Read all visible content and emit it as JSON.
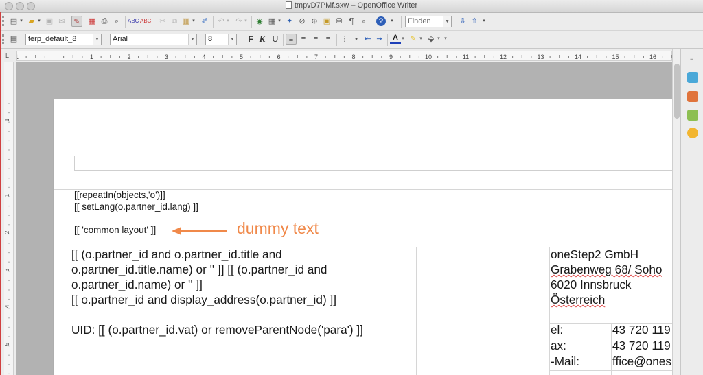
{
  "window": {
    "title": "tmpvD7PMf.sxw – OpenOffice Writer"
  },
  "standard_toolbar": {
    "find_value": "Finden",
    "icons": [
      "new-document-icon",
      "open-folder-icon",
      "save-icon",
      "export-pdf-icon",
      "edit-file-icon",
      "print-icon",
      "page-preview-icon",
      "spellcheck-icon",
      "autospellcheck-icon",
      "cut-icon",
      "copy-icon",
      "paste-icon",
      "format-paintbrush-icon",
      "undo-icon",
      "redo-icon",
      "hyperlink-icon",
      "table-icon",
      "draw-functions-icon",
      "navigator-icon",
      "gallery-icon",
      "data-sources-icon",
      "formatting-marks-icon",
      "zoom-icon",
      "help-icon"
    ]
  },
  "formatting_toolbar": {
    "paragraph_style": "terp_default_8",
    "font_name": "Arial",
    "font_size": "8",
    "bold_label": "F",
    "italic_label": "K",
    "underline_label": "U"
  },
  "ruler": {
    "corner_label": "L",
    "h_labels": [
      "1",
      "1",
      "2",
      "3",
      "4",
      "5",
      "6",
      "7",
      "8",
      "9",
      "10",
      "11",
      "12",
      "13",
      "14",
      "15",
      "16"
    ],
    "v_labels": [
      "1",
      "1",
      "2",
      "3",
      "4",
      "5"
    ]
  },
  "document": {
    "lines": [
      "[[repeatIn(objects,'o')]]",
      "[[ setLang(o.partner_id.lang) ]]",
      "[[ 'common layout' ]]"
    ],
    "annotation": "dummy text",
    "address_lines": [
      "[[ (o.partner_id and o.partner_id.title and",
      "o.partner_id.title.name) or '' ]] [[ (o.partner_id and",
      "o.partner_id.name) or '' ]]",
      "[[ o.partner_id and display_address(o.partner_id) ]]"
    ],
    "uid_line": "UID: [[ (o.partner_id.vat) or removeParentNode('para') ]]",
    "company_lines": [
      "oneStep2 GmbH",
      "Grabenweg 68/ Soho",
      "6020 Innsbruck",
      "Österreich"
    ],
    "contact_labels": [
      "el:",
      "ax:",
      "-Mail:"
    ],
    "contact_values": [
      "43 720 119",
      "43 720 119",
      "ffice@ones"
    ]
  },
  "colors": {
    "annotation": "#f0894a",
    "spell_error": "#e04848"
  }
}
